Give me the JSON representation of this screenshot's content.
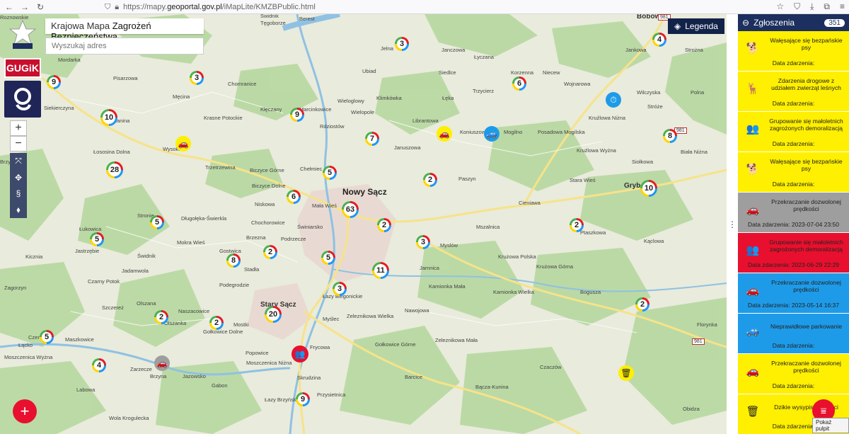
{
  "browser": {
    "url_prefix": "https://mapy.",
    "url_host": "geoportal.gov.pl",
    "url_path": "/iMapLite/KMZBPublic.html"
  },
  "header": {
    "title_prefix": "Krajowa Mapa ",
    "title_main": "Zagrożeń Bezpieczeństwa",
    "search_placeholder": "Wyszukaj adres",
    "gugik_label": "GUGiK",
    "police_label": "POLICJA",
    "legend_label": "Legenda"
  },
  "map": {
    "places": [
      {
        "name": "Nowy Sącz",
        "cls": "city"
      },
      {
        "name": "Stary Sącz",
        "cls": "town"
      },
      {
        "name": "Grybów",
        "cls": "town"
      },
      {
        "name": "Bobowa",
        "cls": "town"
      },
      {
        "name": "Świdnik",
        "cls": ""
      },
      {
        "name": "Tęgoborze",
        "cls": ""
      },
      {
        "name": "Jelna",
        "cls": ""
      },
      {
        "name": "Janczowa",
        "cls": ""
      },
      {
        "name": "Łyczana",
        "cls": ""
      },
      {
        "name": "Siedlce",
        "cls": ""
      },
      {
        "name": "Korzenna",
        "cls": ""
      },
      {
        "name": "Niecew",
        "cls": ""
      },
      {
        "name": "Jankowa",
        "cls": ""
      },
      {
        "name": "Strożna",
        "cls": ""
      },
      {
        "name": "Mordarka",
        "cls": ""
      },
      {
        "name": "Pisarzowa",
        "cls": ""
      },
      {
        "name": "Męcina",
        "cls": ""
      },
      {
        "name": "Chomranice",
        "cls": ""
      },
      {
        "name": "Ubiad",
        "cls": ""
      },
      {
        "name": "Wieloglowy",
        "cls": ""
      },
      {
        "name": "Klimkówka",
        "cls": ""
      },
      {
        "name": "Łęka",
        "cls": ""
      },
      {
        "name": "Trzycierz",
        "cls": ""
      },
      {
        "name": "Wojnarowa",
        "cls": ""
      },
      {
        "name": "Wilczyska",
        "cls": ""
      },
      {
        "name": "Polna",
        "cls": ""
      },
      {
        "name": "Siekierczyna",
        "cls": ""
      },
      {
        "name": "Kanina",
        "cls": ""
      },
      {
        "name": "Krasne Potockie",
        "cls": ""
      },
      {
        "name": "Kłęczany",
        "cls": ""
      },
      {
        "name": "Marcinkowice",
        "cls": ""
      },
      {
        "name": "Rdziostów",
        "cls": ""
      },
      {
        "name": "Wielopole",
        "cls": ""
      },
      {
        "name": "Librantowa",
        "cls": ""
      },
      {
        "name": "Koniuszowa",
        "cls": ""
      },
      {
        "name": "Mogilno",
        "cls": ""
      },
      {
        "name": "Posadowa Mogilska",
        "cls": ""
      },
      {
        "name": "Kruźlowa Niżna",
        "cls": ""
      },
      {
        "name": "Kruźlowa Wyżna",
        "cls": ""
      },
      {
        "name": "Stróże",
        "cls": ""
      },
      {
        "name": "Biała Niżna",
        "cls": ""
      },
      {
        "name": "Wysokie",
        "cls": ""
      },
      {
        "name": "Trzetrzewina",
        "cls": ""
      },
      {
        "name": "Januszowa",
        "cls": ""
      },
      {
        "name": "Siołkowa",
        "cls": ""
      },
      {
        "name": "Brzyna",
        "cls": ""
      },
      {
        "name": "Łososina Dolna",
        "cls": ""
      },
      {
        "name": "Biczyce Górne",
        "cls": ""
      },
      {
        "name": "Chełmiec",
        "cls": ""
      },
      {
        "name": "Biczyce Dolne",
        "cls": ""
      },
      {
        "name": "Niskowa",
        "cls": ""
      },
      {
        "name": "Mała Wieś",
        "cls": ""
      },
      {
        "name": "Paszyn",
        "cls": ""
      },
      {
        "name": "Stara Wieś",
        "cls": ""
      },
      {
        "name": "Cieniawa",
        "cls": ""
      },
      {
        "name": "Stronie",
        "cls": ""
      },
      {
        "name": "Długołęka-Świerkla",
        "cls": ""
      },
      {
        "name": "Chochorowice",
        "cls": ""
      },
      {
        "name": "Świniarsko",
        "cls": ""
      },
      {
        "name": "Mszalnica",
        "cls": ""
      },
      {
        "name": "Ptaszkowa",
        "cls": ""
      },
      {
        "name": "Kąclowa",
        "cls": ""
      },
      {
        "name": "Łukowica",
        "cls": ""
      },
      {
        "name": "Jastrzębie",
        "cls": ""
      },
      {
        "name": "Mokra Wieś",
        "cls": ""
      },
      {
        "name": "Brzezna",
        "cls": ""
      },
      {
        "name": "Podrzecze",
        "cls": ""
      },
      {
        "name": "Myslów",
        "cls": ""
      },
      {
        "name": "Krużowa Polska",
        "cls": ""
      },
      {
        "name": "Krużowa Górna",
        "cls": ""
      },
      {
        "name": "Kicznia",
        "cls": ""
      },
      {
        "name": "Świdnik",
        "cls": ""
      },
      {
        "name": "Gostwica",
        "cls": ""
      },
      {
        "name": "Stadła",
        "cls": ""
      },
      {
        "name": "Jamnica",
        "cls": ""
      },
      {
        "name": "Jadamwola",
        "cls": ""
      },
      {
        "name": "Czarny Potok",
        "cls": ""
      },
      {
        "name": "Podegrodzie",
        "cls": ""
      },
      {
        "name": "Kamionka Mała",
        "cls": ""
      },
      {
        "name": "Kamionka Wielka",
        "cls": ""
      },
      {
        "name": "Bogusza",
        "cls": ""
      },
      {
        "name": "Zagorzyn",
        "cls": ""
      },
      {
        "name": "Łazy Biegonickie",
        "cls": ""
      },
      {
        "name": "Szczereż",
        "cls": ""
      },
      {
        "name": "Olszana",
        "cls": ""
      },
      {
        "name": "Naszacowice",
        "cls": ""
      },
      {
        "name": "Zeleznikowa Wielka",
        "cls": ""
      },
      {
        "name": "Nawojowa",
        "cls": ""
      },
      {
        "name": "Olszanka",
        "cls": ""
      },
      {
        "name": "Mostki",
        "cls": ""
      },
      {
        "name": "Myślec",
        "cls": ""
      },
      {
        "name": "Florynka",
        "cls": ""
      },
      {
        "name": "Łącko",
        "cls": ""
      },
      {
        "name": "Czerniec",
        "cls": ""
      },
      {
        "name": "Maszkowice",
        "cls": ""
      },
      {
        "name": "Gołkowice Dolne",
        "cls": ""
      },
      {
        "name": "Gołkowice Górne",
        "cls": ""
      },
      {
        "name": "Zeleznikowa Mała",
        "cls": ""
      },
      {
        "name": "Frycowa",
        "cls": ""
      },
      {
        "name": "Popowice",
        "cls": ""
      },
      {
        "name": "Moszczenica Niżna",
        "cls": ""
      },
      {
        "name": "Moszczenica Wyżna",
        "cls": ""
      },
      {
        "name": "Zarzecze",
        "cls": ""
      },
      {
        "name": "Jazowsko",
        "cls": ""
      },
      {
        "name": "Gabon",
        "cls": ""
      },
      {
        "name": "Skrudzina",
        "cls": ""
      },
      {
        "name": "Barcice",
        "cls": ""
      },
      {
        "name": "Bącza-Kunina",
        "cls": ""
      },
      {
        "name": "Czaczów",
        "cls": ""
      },
      {
        "name": "Labowa",
        "cls": ""
      },
      {
        "name": "Brzyna",
        "cls": ""
      },
      {
        "name": "Łazy Brzyńskie",
        "cls": ""
      },
      {
        "name": "Przysietnica",
        "cls": ""
      },
      {
        "name": "Wola Krogulecka",
        "cls": ""
      },
      {
        "name": "Obidza",
        "cls": ""
      },
      {
        "name": "Berest",
        "cls": ""
      },
      {
        "name": "Roznowskie",
        "cls": ""
      }
    ],
    "roads": [
      "981",
      "981",
      "981"
    ],
    "clusters": [
      "9",
      "3",
      "3",
      "4",
      "6",
      "10",
      "9",
      "7",
      "2",
      "8",
      "28",
      "5",
      "6",
      "63",
      "5",
      "10",
      "2",
      "5",
      "2",
      "3",
      "8",
      "2",
      "5",
      "11",
      "3",
      "2",
      "20",
      "2",
      "2",
      "5",
      "4",
      "9"
    ]
  },
  "panel": {
    "title": "Zgłoszenia",
    "count": "351",
    "cards": [
      {
        "title": "Wałęsające się bezpańskie psy",
        "date_label": "Data zdarzenia:",
        "date": "",
        "color": "#ffef00",
        "icon": "🐕"
      },
      {
        "title": "Zdarzenia drogowe z udziałem zwierząt leśnych",
        "date_label": "Data zdarzenia:",
        "date": "",
        "color": "#ffef00",
        "icon": "🦌"
      },
      {
        "title": "Grupowanie się małoletnich zagrożonych demoralizacją",
        "date_label": "Data zdarzenia:",
        "date": "",
        "color": "#ffef00",
        "icon": "👥"
      },
      {
        "title": "Wałęsające się bezpańskie psy",
        "date_label": "Data zdarzenia:",
        "date": "",
        "color": "#ffef00",
        "icon": "🐕"
      },
      {
        "title": "Przekraczanie dozwolonej prędkości",
        "date_label": "Data zdarzenia:",
        "date": "2023-07-04 23:50",
        "color": "#9e9e9e",
        "icon": "🚗"
      },
      {
        "title": "Grupowanie się małoletnich zagrożonych demoralizacją",
        "date_label": "Data zdarzenia:",
        "date": "2023-06-29 22:29",
        "color": "#e8102e",
        "icon": "👥"
      },
      {
        "title": "Przekraczanie dozwolonej prędkości",
        "date_label": "Data zdarzenia:",
        "date": "2023-05-14 16:37",
        "color": "#1e9be8",
        "icon": "🚗"
      },
      {
        "title": "Nieprawidłowe parkowanie",
        "date_label": "Data zdarzenia:",
        "date": "",
        "color": "#1e9be8",
        "icon": "🚙"
      },
      {
        "title": "Przekraczanie dozwolonej prędkości",
        "date_label": "Data zdarzenia:",
        "date": "",
        "color": "#ffef00",
        "icon": "🚗"
      },
      {
        "title": "Dzikie wysypiska śmieci",
        "date_label": "Data zdarzenia:",
        "date": "",
        "color": "#ffef00",
        "icon": "🗑"
      }
    ]
  },
  "tooltip": "Pokaż pulpit"
}
